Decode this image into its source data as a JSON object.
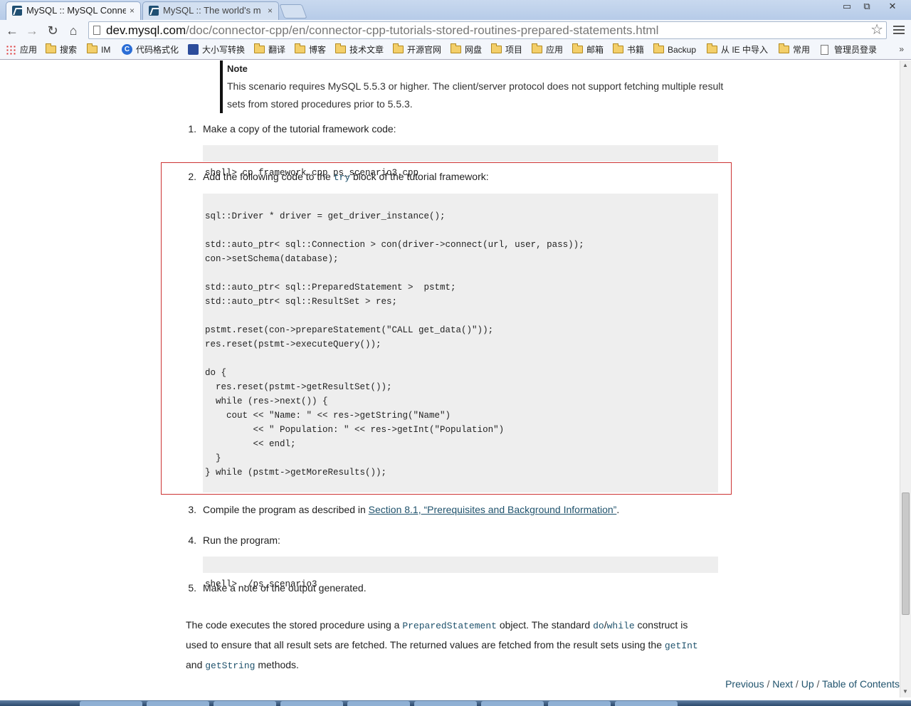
{
  "browser": {
    "tabs": [
      {
        "title": "MySQL :: MySQL Conne",
        "close": "×"
      },
      {
        "title": "MySQL :: The world's m",
        "close": "×"
      }
    ],
    "window_controls": {
      "minimize": "▭",
      "restore": "⧉",
      "close": "✕"
    },
    "address": {
      "host": "dev.mysql.com",
      "path": "/doc/connector-cpp/en/connector-cpp-tutorials-stored-routines-prepared-statements.html"
    },
    "nav": {
      "back": "←",
      "forward": "→",
      "reload": "↻",
      "home": "⌂",
      "star": "☆"
    },
    "bookmarks": [
      "应用",
      "搜索",
      "IM",
      "代码格式化",
      "大小写转换",
      "翻译",
      "博客",
      "技术文章",
      "开源官网",
      "网盘",
      "项目",
      "应用",
      "邮箱",
      "书籍",
      "Backup",
      "从 IE 中导入",
      "常用",
      "管理员登录"
    ],
    "bookmarks_more": "»"
  },
  "note": {
    "title": "Note",
    "body": "This scenario requires MySQL 5.5.3 or higher. The client/server protocol does not support fetching multiple result sets from stored procedures prior to 5.5.3."
  },
  "steps": {
    "s1": {
      "num": "1.",
      "text": "Make a copy of the tutorial framework code:"
    },
    "s1_code": "shell> cp framework.cpp ps_scenario3.cpp",
    "s2": {
      "num": "2.",
      "text_before": "Add the following code to the ",
      "code": "try",
      "text_after": " block of the tutorial framework:"
    },
    "s2_code": [
      "",
      "sql::Driver * driver = get_driver_instance();",
      "",
      "std::auto_ptr< sql::Connection > con(driver->connect(url, user, pass));",
      "con->setSchema(database);",
      "",
      "std::auto_ptr< sql::PreparedStatement >  pstmt;",
      "std::auto_ptr< sql::ResultSet > res;",
      "",
      "pstmt.reset(con->prepareStatement(\"CALL get_data()\"));",
      "res.reset(pstmt->executeQuery());",
      "",
      "do {",
      "  res.reset(pstmt->getResultSet());",
      "  while (res->next()) {",
      "    cout << \"Name: \" << res->getString(\"Name\")",
      "         << \" Population: \" << res->getInt(\"Population\")",
      "         << endl;",
      "  }",
      "} while (pstmt->getMoreResults());"
    ],
    "s3": {
      "num": "3.",
      "text_before": "Compile the program as described in ",
      "link": "Section 8.1, “Prerequisites and Background Information”",
      "text_after": "."
    },
    "s4": {
      "num": "4.",
      "text": "Run the program:"
    },
    "s4_code": "shell> ./ps_scenario3",
    "s5": {
      "num": "5.",
      "text": "Make a note of the output generated."
    }
  },
  "paragraph": {
    "t1": "The code executes the stored procedure using a ",
    "c1": "PreparedStatement",
    "t2": " object. The standard ",
    "c2": "do",
    "t3": "/",
    "c3": "while",
    "t4": " construct is used to ensure that all result sets are fetched. The returned values are fetched from the result sets using the ",
    "c4": "getInt",
    "t5": " and ",
    "c5": "getString",
    "t6": " methods."
  },
  "footer": {
    "previous": "Previous",
    "next": "Next",
    "up": "Up",
    "toc": "Table of Contents",
    "sep": "/"
  }
}
